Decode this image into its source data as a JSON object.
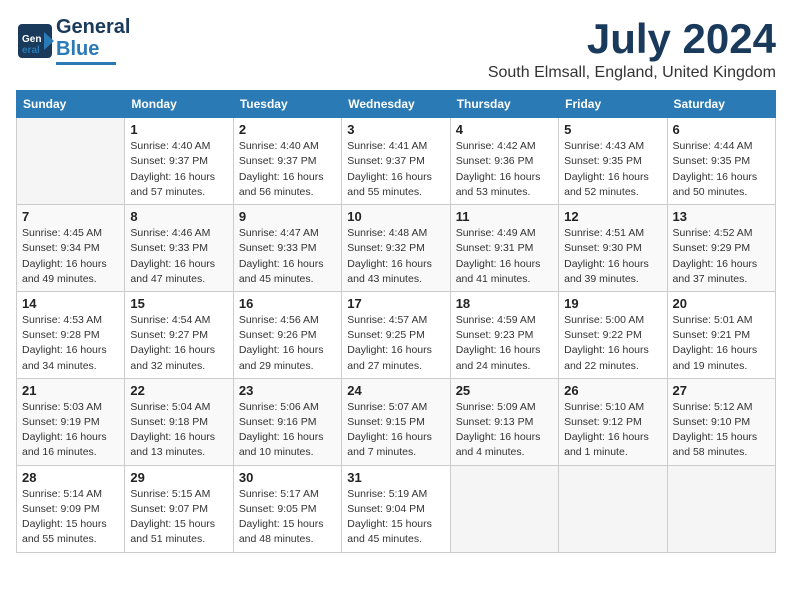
{
  "header": {
    "logo_line1": "General",
    "logo_line2": "Blue",
    "month_year": "July 2024",
    "location": "South Elmsall, England, United Kingdom"
  },
  "columns": [
    "Sunday",
    "Monday",
    "Tuesday",
    "Wednesday",
    "Thursday",
    "Friday",
    "Saturday"
  ],
  "weeks": [
    [
      {
        "day": "",
        "info": ""
      },
      {
        "day": "1",
        "info": "Sunrise: 4:40 AM\nSunset: 9:37 PM\nDaylight: 16 hours\nand 57 minutes."
      },
      {
        "day": "2",
        "info": "Sunrise: 4:40 AM\nSunset: 9:37 PM\nDaylight: 16 hours\nand 56 minutes."
      },
      {
        "day": "3",
        "info": "Sunrise: 4:41 AM\nSunset: 9:37 PM\nDaylight: 16 hours\nand 55 minutes."
      },
      {
        "day": "4",
        "info": "Sunrise: 4:42 AM\nSunset: 9:36 PM\nDaylight: 16 hours\nand 53 minutes."
      },
      {
        "day": "5",
        "info": "Sunrise: 4:43 AM\nSunset: 9:35 PM\nDaylight: 16 hours\nand 52 minutes."
      },
      {
        "day": "6",
        "info": "Sunrise: 4:44 AM\nSunset: 9:35 PM\nDaylight: 16 hours\nand 50 minutes."
      }
    ],
    [
      {
        "day": "7",
        "info": "Sunrise: 4:45 AM\nSunset: 9:34 PM\nDaylight: 16 hours\nand 49 minutes."
      },
      {
        "day": "8",
        "info": "Sunrise: 4:46 AM\nSunset: 9:33 PM\nDaylight: 16 hours\nand 47 minutes."
      },
      {
        "day": "9",
        "info": "Sunrise: 4:47 AM\nSunset: 9:33 PM\nDaylight: 16 hours\nand 45 minutes."
      },
      {
        "day": "10",
        "info": "Sunrise: 4:48 AM\nSunset: 9:32 PM\nDaylight: 16 hours\nand 43 minutes."
      },
      {
        "day": "11",
        "info": "Sunrise: 4:49 AM\nSunset: 9:31 PM\nDaylight: 16 hours\nand 41 minutes."
      },
      {
        "day": "12",
        "info": "Sunrise: 4:51 AM\nSunset: 9:30 PM\nDaylight: 16 hours\nand 39 minutes."
      },
      {
        "day": "13",
        "info": "Sunrise: 4:52 AM\nSunset: 9:29 PM\nDaylight: 16 hours\nand 37 minutes."
      }
    ],
    [
      {
        "day": "14",
        "info": "Sunrise: 4:53 AM\nSunset: 9:28 PM\nDaylight: 16 hours\nand 34 minutes."
      },
      {
        "day": "15",
        "info": "Sunrise: 4:54 AM\nSunset: 9:27 PM\nDaylight: 16 hours\nand 32 minutes."
      },
      {
        "day": "16",
        "info": "Sunrise: 4:56 AM\nSunset: 9:26 PM\nDaylight: 16 hours\nand 29 minutes."
      },
      {
        "day": "17",
        "info": "Sunrise: 4:57 AM\nSunset: 9:25 PM\nDaylight: 16 hours\nand 27 minutes."
      },
      {
        "day": "18",
        "info": "Sunrise: 4:59 AM\nSunset: 9:23 PM\nDaylight: 16 hours\nand 24 minutes."
      },
      {
        "day": "19",
        "info": "Sunrise: 5:00 AM\nSunset: 9:22 PM\nDaylight: 16 hours\nand 22 minutes."
      },
      {
        "day": "20",
        "info": "Sunrise: 5:01 AM\nSunset: 9:21 PM\nDaylight: 16 hours\nand 19 minutes."
      }
    ],
    [
      {
        "day": "21",
        "info": "Sunrise: 5:03 AM\nSunset: 9:19 PM\nDaylight: 16 hours\nand 16 minutes."
      },
      {
        "day": "22",
        "info": "Sunrise: 5:04 AM\nSunset: 9:18 PM\nDaylight: 16 hours\nand 13 minutes."
      },
      {
        "day": "23",
        "info": "Sunrise: 5:06 AM\nSunset: 9:16 PM\nDaylight: 16 hours\nand 10 minutes."
      },
      {
        "day": "24",
        "info": "Sunrise: 5:07 AM\nSunset: 9:15 PM\nDaylight: 16 hours\nand 7 minutes."
      },
      {
        "day": "25",
        "info": "Sunrise: 5:09 AM\nSunset: 9:13 PM\nDaylight: 16 hours\nand 4 minutes."
      },
      {
        "day": "26",
        "info": "Sunrise: 5:10 AM\nSunset: 9:12 PM\nDaylight: 16 hours\nand 1 minute."
      },
      {
        "day": "27",
        "info": "Sunrise: 5:12 AM\nSunset: 9:10 PM\nDaylight: 15 hours\nand 58 minutes."
      }
    ],
    [
      {
        "day": "28",
        "info": "Sunrise: 5:14 AM\nSunset: 9:09 PM\nDaylight: 15 hours\nand 55 minutes."
      },
      {
        "day": "29",
        "info": "Sunrise: 5:15 AM\nSunset: 9:07 PM\nDaylight: 15 hours\nand 51 minutes."
      },
      {
        "day": "30",
        "info": "Sunrise: 5:17 AM\nSunset: 9:05 PM\nDaylight: 15 hours\nand 48 minutes."
      },
      {
        "day": "31",
        "info": "Sunrise: 5:19 AM\nSunset: 9:04 PM\nDaylight: 15 hours\nand 45 minutes."
      },
      {
        "day": "",
        "info": ""
      },
      {
        "day": "",
        "info": ""
      },
      {
        "day": "",
        "info": ""
      }
    ]
  ]
}
